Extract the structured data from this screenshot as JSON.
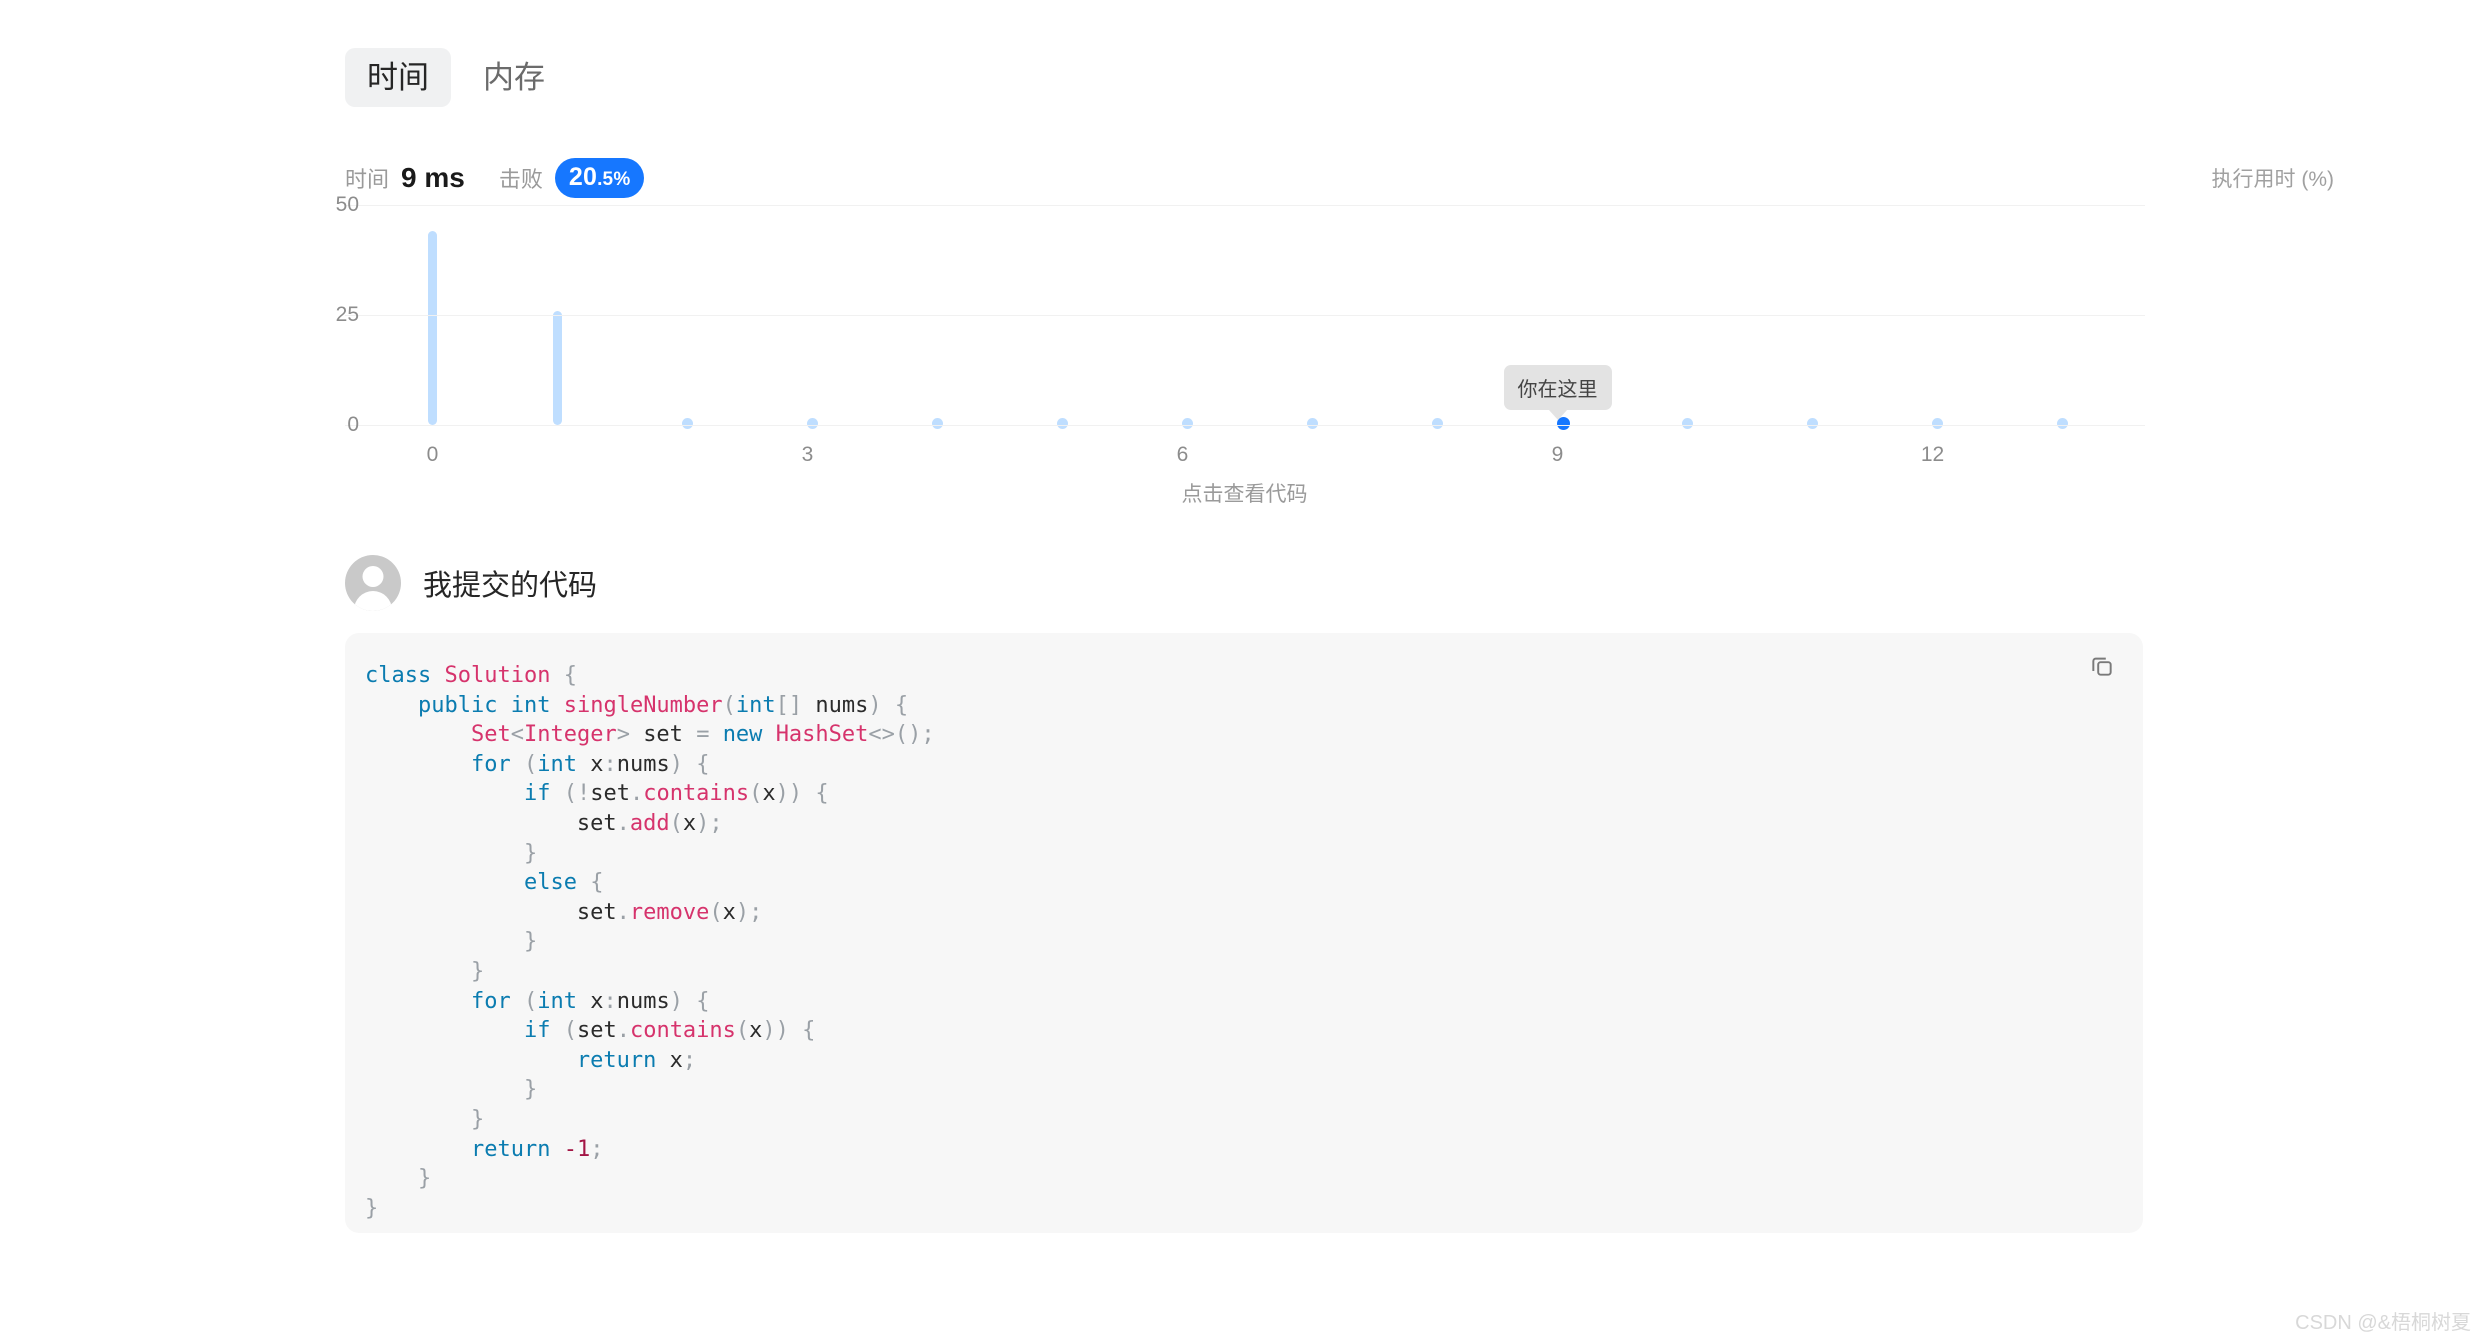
{
  "tabs": [
    {
      "label": "时间",
      "active": true
    },
    {
      "label": "内存",
      "active": false
    }
  ],
  "stats": {
    "time_label": "时间",
    "time_value": "9 ms",
    "beats_label": "击败",
    "beats_big": "20",
    "beats_small": ".5%",
    "badge_color": "#1677ff"
  },
  "chart_axis_title": "执行用时 (%)",
  "tooltip": {
    "text": "你在这里"
  },
  "click_hint": "点击查看代码",
  "user": {
    "title": "我提交的代码",
    "avatar": "person-avatar"
  },
  "code_block": {
    "copy_icon": "copy-icon",
    "language": "java",
    "lines": [
      "class Solution {",
      "    public int singleNumber(int[] nums) {",
      "        Set<Integer> set = new HashSet<>();",
      "        for (int x:nums) {",
      "            if (!set.contains(x)) {",
      "                set.add(x);",
      "            }",
      "            else {",
      "                set.remove(x);",
      "            }",
      "        }",
      "        for (int x:nums) {",
      "            if (set.contains(x)) {",
      "                return x;",
      "            }",
      "        }",
      "        return -1;",
      "    }",
      "}"
    ]
  },
  "watermark": "CSDN @&梧桐树夏",
  "chart_data": {
    "type": "bar",
    "title": "",
    "xlabel": "",
    "ylabel": "执行用时 (%)",
    "x": [
      0,
      1,
      2,
      3,
      4,
      5,
      6,
      7,
      8,
      9,
      10,
      11,
      12,
      13
    ],
    "values": [
      44,
      26,
      1,
      1,
      1,
      1,
      1,
      1,
      1,
      1,
      1,
      1,
      1,
      1
    ],
    "highlight_index": 9,
    "highlight_label": "你在这里",
    "xticks": [
      0,
      3,
      6,
      9,
      12
    ],
    "yticks": [
      0,
      25,
      50
    ],
    "xlim": [
      -0.7,
      13.7
    ],
    "ylim": [
      0,
      50
    ],
    "grid": true,
    "legend": "none",
    "bar_color": "#bfdeff",
    "highlight_color": "#1677ff"
  }
}
